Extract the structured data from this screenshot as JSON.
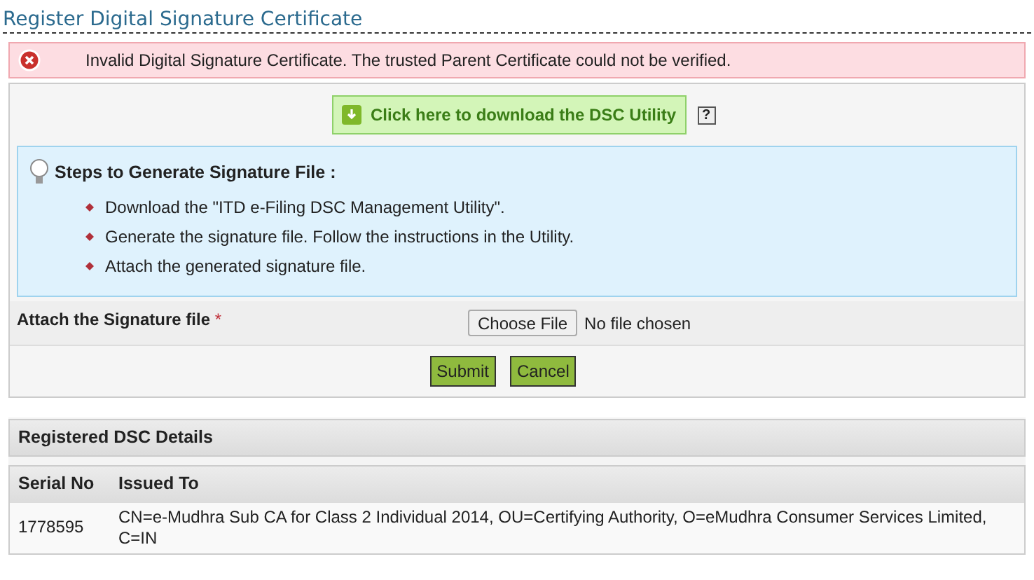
{
  "page_title": "Register Digital Signature Certificate",
  "error": {
    "message": "Invalid Digital Signature Certificate. The trusted Parent Certificate could not be verified."
  },
  "download_button": "Click here to download the DSC Utility",
  "help_icon": "?",
  "steps": {
    "title": "Steps to Generate Signature File :",
    "items": [
      "Download the \"ITD e-Filing DSC Management Utility\".",
      "Generate the signature file. Follow the instructions in the Utility.",
      "Attach the generated signature file."
    ]
  },
  "attach": {
    "label": "Attach the Signature file",
    "required_mark": "*",
    "button": "Choose File",
    "status": "No file chosen"
  },
  "buttons": [
    "Submit",
    "Cancel"
  ],
  "registered": {
    "title": "Registered DSC Details",
    "columns": [
      "Serial No",
      "Issued To"
    ],
    "rows": [
      [
        "1778595",
        "CN=e-Mudhra Sub CA for Class 2 Individual 2014, OU=Certifying Authority, O=eMudhra Consumer Services Limited, C=IN"
      ]
    ]
  }
}
